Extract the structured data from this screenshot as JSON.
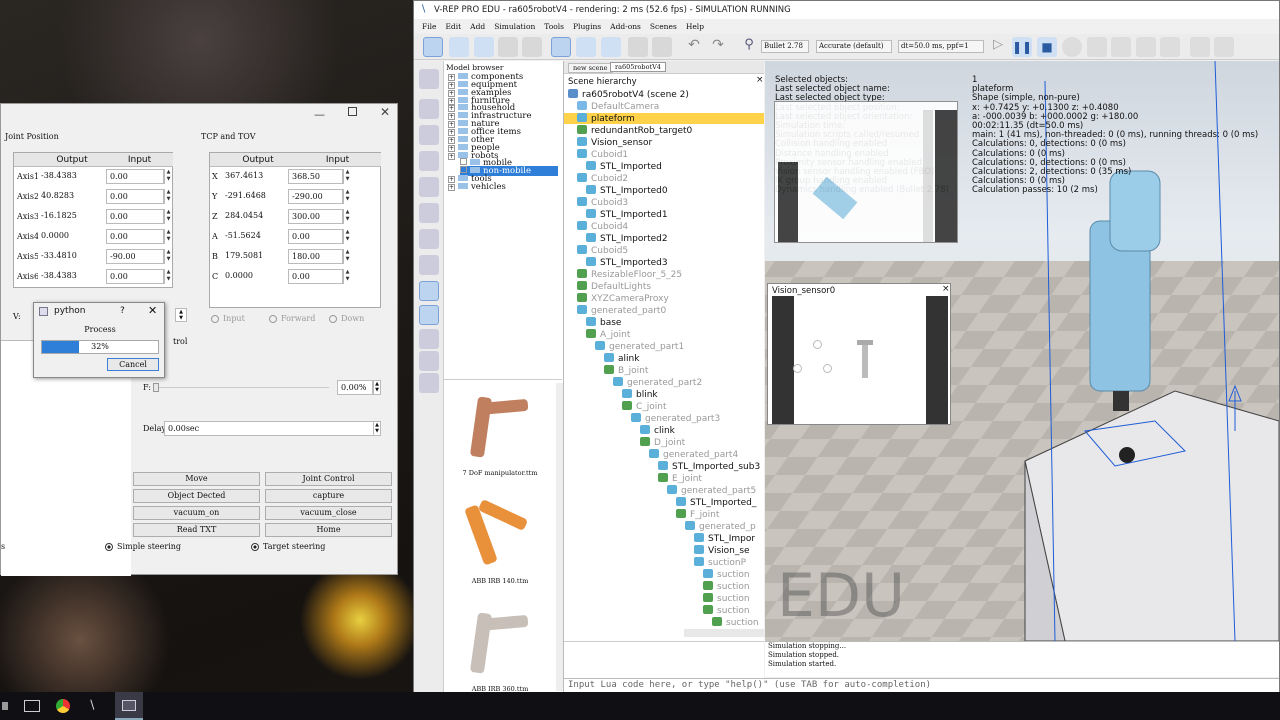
{
  "vrep": {
    "title": "V-REP PRO EDU - ra605robotV4 - rendering: 2 ms (52.6 fps) - SIMULATION RUNNING",
    "menu": [
      "File",
      "Edit",
      "Add",
      "Simulation",
      "Tools",
      "Plugins",
      "Add-ons",
      "Scenes",
      "Help"
    ],
    "engine": "Bullet 2.78",
    "accuracy": "Accurate (default)",
    "dt": "dt=50.0 ms, ppf=1",
    "tabs": [
      "new scene",
      "ra605robotV4"
    ],
    "model_browser_title": "Model browser",
    "model_tree": [
      {
        "label": "components",
        "depth": 0,
        "sel": false
      },
      {
        "label": "equipment",
        "depth": 0,
        "sel": false
      },
      {
        "label": "examples",
        "depth": 0,
        "sel": false
      },
      {
        "label": "furniture",
        "depth": 0,
        "sel": false
      },
      {
        "label": "household",
        "depth": 0,
        "sel": false
      },
      {
        "label": "infrastructure",
        "depth": 0,
        "sel": false
      },
      {
        "label": "nature",
        "depth": 0,
        "sel": false
      },
      {
        "label": "office items",
        "depth": 0,
        "sel": false
      },
      {
        "label": "other",
        "depth": 0,
        "sel": false
      },
      {
        "label": "people",
        "depth": 0,
        "sel": false
      },
      {
        "label": "robots",
        "depth": 0,
        "sel": false
      },
      {
        "label": "mobile",
        "depth": 1,
        "sel": false
      },
      {
        "label": "non-mobile",
        "depth": 1,
        "sel": true
      },
      {
        "label": "tools",
        "depth": 0,
        "sel": false
      },
      {
        "label": "vehicles",
        "depth": 0,
        "sel": false
      }
    ],
    "model_thumbs": [
      {
        "caption": "7 DoF manipulator.ttm",
        "color": "#c08060"
      },
      {
        "caption": "ABB IRB 140.ttm",
        "color": "#e8903a"
      },
      {
        "caption": "ABB IRB 360.ttm",
        "color": "#c8c0b8"
      }
    ],
    "hierarchy_title": "Scene hierarchy",
    "hierarchy": [
      {
        "label": "ra605robotV4 (scene 2)",
        "depth": 0,
        "gray": false,
        "sel": false,
        "c": "#5a8ec8"
      },
      {
        "label": "DefaultCamera",
        "depth": 1,
        "gray": true,
        "sel": false,
        "c": "#7ab8e8"
      },
      {
        "label": "plateform",
        "depth": 1,
        "gray": false,
        "sel": true,
        "c": "#5ab0d8"
      },
      {
        "label": "redundantRob_target0",
        "depth": 1,
        "gray": false,
        "sel": false,
        "c": "#50a050"
      },
      {
        "label": "Vision_sensor",
        "depth": 1,
        "gray": false,
        "sel": false,
        "c": "#5ab0d8"
      },
      {
        "label": "Cuboid1",
        "depth": 1,
        "gray": true,
        "sel": false,
        "c": "#5ab0d8"
      },
      {
        "label": "STL_Imported",
        "depth": 2,
        "gray": false,
        "sel": false,
        "c": "#5ab0d8"
      },
      {
        "label": "Cuboid2",
        "depth": 1,
        "gray": true,
        "sel": false,
        "c": "#5ab0d8"
      },
      {
        "label": "STL_Imported0",
        "depth": 2,
        "gray": false,
        "sel": false,
        "c": "#5ab0d8"
      },
      {
        "label": "Cuboid3",
        "depth": 1,
        "gray": true,
        "sel": false,
        "c": "#5ab0d8"
      },
      {
        "label": "STL_Imported1",
        "depth": 2,
        "gray": false,
        "sel": false,
        "c": "#5ab0d8"
      },
      {
        "label": "Cuboid4",
        "depth": 1,
        "gray": true,
        "sel": false,
        "c": "#5ab0d8"
      },
      {
        "label": "STL_Imported2",
        "depth": 2,
        "gray": false,
        "sel": false,
        "c": "#5ab0d8"
      },
      {
        "label": "Cuboid5",
        "depth": 1,
        "gray": true,
        "sel": false,
        "c": "#5ab0d8"
      },
      {
        "label": "STL_Imported3",
        "depth": 2,
        "gray": false,
        "sel": false,
        "c": "#5ab0d8"
      },
      {
        "label": "ResizableFloor_5_25",
        "depth": 1,
        "gray": true,
        "sel": false,
        "c": "#50a050"
      },
      {
        "label": "DefaultLights",
        "depth": 1,
        "gray": true,
        "sel": false,
        "c": "#50a050"
      },
      {
        "label": "XYZCameraProxy",
        "depth": 1,
        "gray": true,
        "sel": false,
        "c": "#50a050"
      },
      {
        "label": "generated_part0",
        "depth": 1,
        "gray": true,
        "sel": false,
        "c": "#5ab0d8"
      },
      {
        "label": "base",
        "depth": 2,
        "gray": false,
        "sel": false,
        "c": "#5ab0d8"
      },
      {
        "label": "A_joint",
        "depth": 2,
        "gray": true,
        "sel": false,
        "c": "#50a050"
      },
      {
        "label": "generated_part1",
        "depth": 3,
        "gray": true,
        "sel": false,
        "c": "#5ab0d8"
      },
      {
        "label": "alink",
        "depth": 4,
        "gray": false,
        "sel": false,
        "c": "#5ab0d8"
      },
      {
        "label": "B_joint",
        "depth": 4,
        "gray": true,
        "sel": false,
        "c": "#50a050"
      },
      {
        "label": "generated_part2",
        "depth": 5,
        "gray": true,
        "sel": false,
        "c": "#5ab0d8"
      },
      {
        "label": "blink",
        "depth": 6,
        "gray": false,
        "sel": false,
        "c": "#5ab0d8"
      },
      {
        "label": "C_joint",
        "depth": 6,
        "gray": true,
        "sel": false,
        "c": "#50a050"
      },
      {
        "label": "generated_part3",
        "depth": 7,
        "gray": true,
        "sel": false,
        "c": "#5ab0d8"
      },
      {
        "label": "clink",
        "depth": 8,
        "gray": false,
        "sel": false,
        "c": "#5ab0d8"
      },
      {
        "label": "D_joint",
        "depth": 8,
        "gray": true,
        "sel": false,
        "c": "#50a050"
      },
      {
        "label": "generated_part4",
        "depth": 9,
        "gray": true,
        "sel": false,
        "c": "#5ab0d8"
      },
      {
        "label": "STL_Imported_sub3",
        "depth": 10,
        "gray": false,
        "sel": false,
        "c": "#5ab0d8"
      },
      {
        "label": "E_joint",
        "depth": 10,
        "gray": true,
        "sel": false,
        "c": "#50a050"
      },
      {
        "label": "generated_part5",
        "depth": 11,
        "gray": true,
        "sel": false,
        "c": "#5ab0d8"
      },
      {
        "label": "STL_Imported_",
        "depth": 12,
        "gray": false,
        "sel": false,
        "c": "#5ab0d8"
      },
      {
        "label": "F_joint",
        "depth": 12,
        "gray": true,
        "sel": false,
        "c": "#50a050"
      },
      {
        "label": "generated_p",
        "depth": 13,
        "gray": true,
        "sel": false,
        "c": "#5ab0d8"
      },
      {
        "label": "STL_Impor",
        "depth": 14,
        "gray": false,
        "sel": false,
        "c": "#5ab0d8"
      },
      {
        "label": "Vision_se",
        "depth": 14,
        "gray": false,
        "sel": false,
        "c": "#5ab0d8"
      },
      {
        "label": "suctionP",
        "depth": 14,
        "gray": true,
        "sel": false,
        "c": "#5ab0d8"
      },
      {
        "label": "suction",
        "depth": 15,
        "gray": true,
        "sel": false,
        "c": "#5ab0d8"
      },
      {
        "label": "suction",
        "depth": 15,
        "gray": true,
        "sel": false,
        "c": "#50a050"
      },
      {
        "label": "suction",
        "depth": 15,
        "gray": true,
        "sel": false,
        "c": "#50a050"
      },
      {
        "label": "suction",
        "depth": 15,
        "gray": true,
        "sel": false,
        "c": "#50a050"
      },
      {
        "label": "suction",
        "depth": 16,
        "gray": true,
        "sel": false,
        "c": "#50a050"
      }
    ],
    "info_left": [
      "Selected objects:",
      "Last selected object name:",
      "Last selected object type:",
      "Last selected object position:",
      "Last selected object orientation:",
      "Simulation time:",
      "Simulation scripts called/resumed",
      "Collision handling enabled",
      "Distance handling enabled",
      "Proximity sensor handling enabled",
      "Vision sensor handling enabled (FBO)",
      "IK group handling enabled",
      "Dynamics handling enabled (Bullet 2.78)"
    ],
    "info_right": [
      "1",
      "plateform",
      "Shape (simple, non-pure)",
      "x: +0.7425   y: +0.1300   z: +0.4080",
      "a: -000.0039   b: +000.0002   g: +180.00",
      "00:02:11.35 (dt=50.0 ms)",
      "main: 1 (41 ms), non-threaded: 0 (0 ms), running threads: 0 (0 ms)",
      "Calculations: 0, detections: 0 (0 ms)",
      "Calculations: 0 (0 ms)",
      "Calculations: 0, detections: 0 (0 ms)",
      "Calculations: 2, detections: 0 (35 ms)",
      "Calculations: 0 (0 ms)",
      "Calculation passes: 10 (2 ms)"
    ],
    "vision_title": "Vision_sensor0",
    "watermark": "EDU",
    "console": [
      "Simulation stopping...",
      "Simulation stopped.",
      "Simulation started."
    ],
    "lua_placeholder": "Input Lua code here, or type \"help()\" (use TAB for auto-completion)"
  },
  "leftapp": {
    "joint_title": "Joint Position",
    "tcp_title": "TCP and TOV",
    "col_output": "Output",
    "col_input": "Input",
    "joints": [
      {
        "label": "Axis1",
        "out": "-38.4383",
        "in": "0.00"
      },
      {
        "label": "Axis2",
        "out": "40.8283",
        "in": "0.00"
      },
      {
        "label": "Axis3",
        "out": "-16.1825",
        "in": "0.00"
      },
      {
        "label": "Axis4",
        "out": "0.0000",
        "in": "0.00"
      },
      {
        "label": "Axis5",
        "out": "-33.4810",
        "in": "-90.00"
      },
      {
        "label": "Axis6",
        "out": "-38.4383",
        "in": "0.00"
      }
    ],
    "tcp": [
      {
        "label": "X",
        "out": "367.4613",
        "in": "368.50"
      },
      {
        "label": "Y",
        "out": "-291.6468",
        "in": "-290.00"
      },
      {
        "label": "Z",
        "out": "284.0454",
        "in": "300.00"
      },
      {
        "label": "A",
        "out": "-51.5624",
        "in": "0.00"
      },
      {
        "label": "B",
        "out": "179.5081",
        "in": "180.00"
      },
      {
        "label": "C",
        "out": "0.0000",
        "in": "0.00"
      }
    ],
    "radios": [
      "Input",
      "Forward",
      "Down"
    ],
    "v_label": "V:",
    "f_label": "F:",
    "f_value": "0.00%",
    "delay_label": "Delay",
    "delay_value": "0.00sec",
    "trol_label": "trol",
    "buttons": [
      "Move",
      "Joint Control",
      "Object Dected",
      "capture",
      "vacuum_on",
      "vacuum_close",
      "Read TXT",
      "Home"
    ],
    "steering": [
      "s",
      "Simple steering",
      "Target steering"
    ]
  },
  "dialog": {
    "title": "python",
    "help": "?",
    "label": "Process",
    "progress": 32,
    "progress_text": "32%",
    "cancel": "Cancel"
  }
}
